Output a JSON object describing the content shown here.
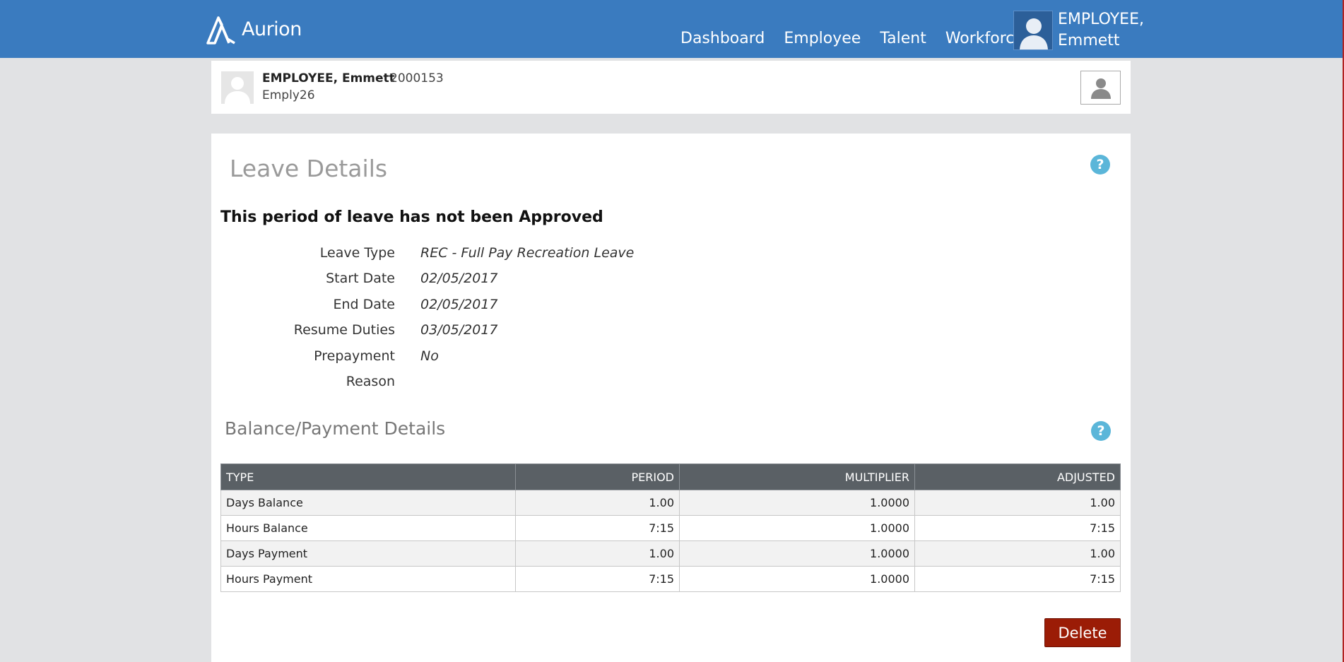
{
  "app": {
    "logo_text": "Aurion",
    "nav": [
      "Dashboard",
      "Employee",
      "Talent",
      "Workforce"
    ],
    "user_line1": "EMPLOYEE,",
    "user_line2": "Emmett"
  },
  "employee": {
    "name": "EMPLOYEE, Emmett",
    "id": "2000153",
    "username": "Emply26"
  },
  "leave": {
    "title": "Leave Details",
    "status_message": "This period of leave has not been Approved",
    "fields": [
      {
        "label": "Leave Type",
        "value": "REC - Full Pay Recreation Leave"
      },
      {
        "label": "Start Date",
        "value": "02/05/2017"
      },
      {
        "label": "End Date",
        "value": "02/05/2017"
      },
      {
        "label": "Resume Duties",
        "value": "03/05/2017"
      },
      {
        "label": "Prepayment",
        "value": "No"
      },
      {
        "label": "Reason",
        "value": ""
      }
    ]
  },
  "balance": {
    "title": "Balance/Payment Details",
    "headers": [
      "TYPE",
      "PERIOD",
      "MULTIPLIER",
      "ADJUSTED"
    ],
    "rows": [
      [
        "Days Balance",
        "1.00",
        "1.0000",
        "1.00"
      ],
      [
        "Hours Balance",
        "7:15",
        "1.0000",
        "7:15"
      ],
      [
        "Days Payment",
        "1.00",
        "1.0000",
        "1.00"
      ],
      [
        "Hours Payment",
        "7:15",
        "1.0000",
        "7:15"
      ]
    ]
  },
  "actions": {
    "delete_label": "Delete"
  },
  "colors": {
    "topbar": "#3a7bbf",
    "delete": "#9b1c06",
    "help": "#5bb6d9",
    "table_header": "#5a6065"
  },
  "icons": {
    "logo": "aurion-logo-icon",
    "help": "help-icon",
    "avatar": "user-silhouette-icon"
  }
}
